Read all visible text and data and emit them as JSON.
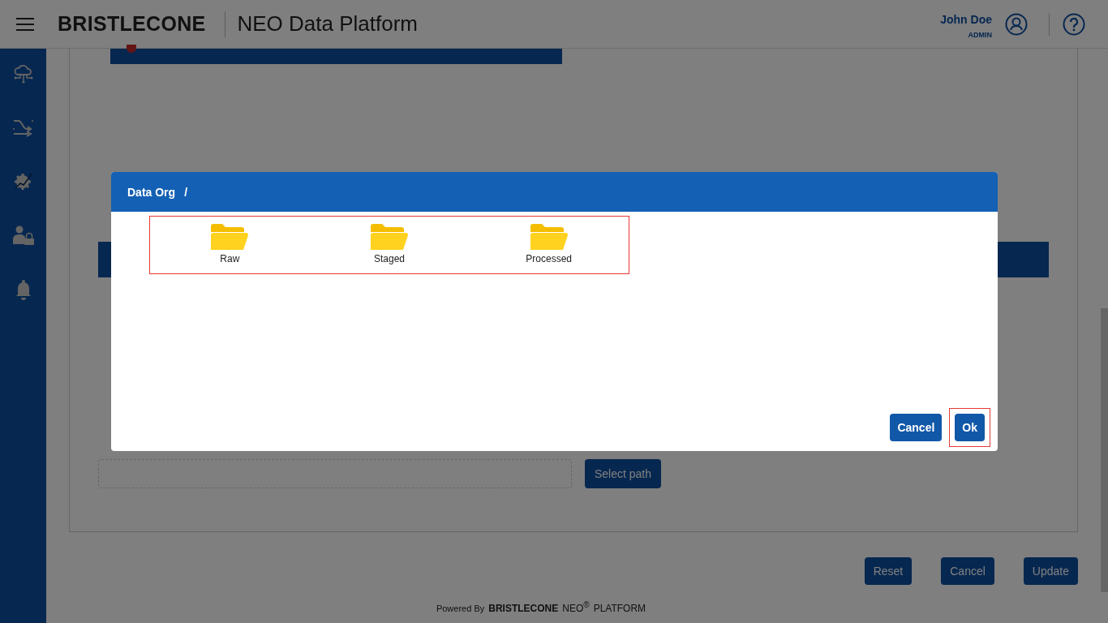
{
  "header": {
    "brand": "BRISTLECONE",
    "title": "NEO Data Platform",
    "user": {
      "name": "John Doe",
      "role": "ADMIN"
    }
  },
  "form": {
    "select_button": "Select path"
  },
  "actions": [
    "Reset",
    "Cancel",
    "Update"
  ],
  "footer": {
    "prefix": "Powered By",
    "brand": "BRISTLECONE",
    "product": "NEO$^{®}$",
    "suffix": "PLATFORM"
  },
  "dialog": {
    "breadcrumb": [
      "Data Org",
      "/"
    ],
    "folders_highlighted": true,
    "folders": [
      {
        "name": "Raw"
      },
      {
        "name": "Staged"
      },
      {
        "name": "Processed"
      }
    ],
    "buttons": [
      {
        "label": "Cancel",
        "highlighted": false
      },
      {
        "label": "Ok",
        "highlighted": true
      }
    ]
  }
}
